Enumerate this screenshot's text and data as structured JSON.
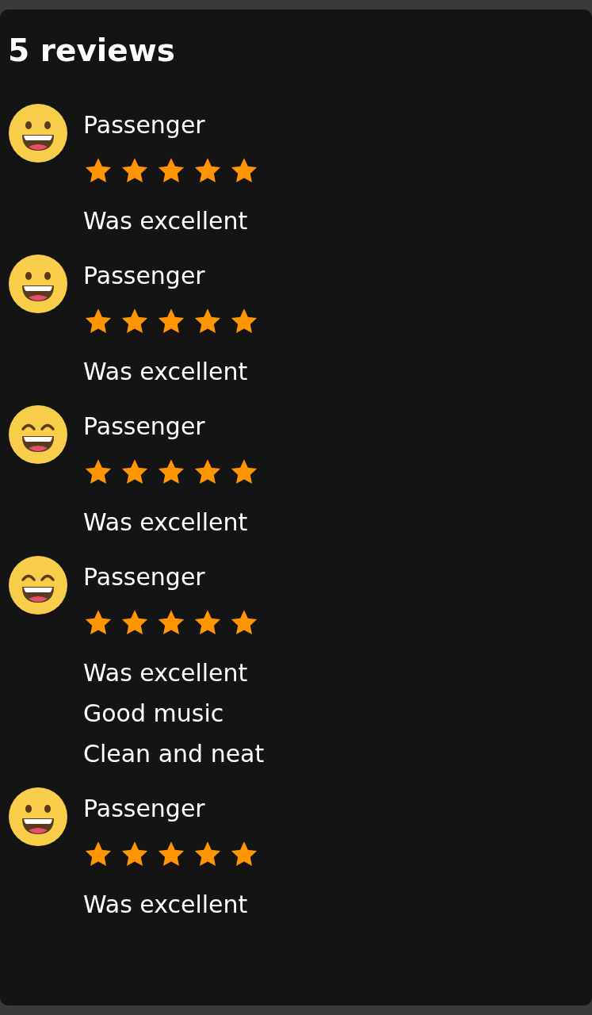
{
  "title": "5 reviews",
  "reviews": [
    {
      "avatar": {
        "kind": "grinning"
      },
      "name": "Passenger",
      "stars": 5,
      "comments": [
        "Was excellent"
      ]
    },
    {
      "avatar": {
        "kind": "grinning"
      },
      "name": "Passenger",
      "stars": 5,
      "comments": [
        "Was excellent"
      ]
    },
    {
      "avatar": {
        "kind": "beaming"
      },
      "name": "Passenger",
      "stars": 5,
      "comments": [
        "Was excellent"
      ]
    },
    {
      "avatar": {
        "kind": "beaming"
      },
      "name": "Passenger",
      "stars": 5,
      "comments": [
        "Was excellent",
        "Good music",
        "Clean and neat"
      ]
    },
    {
      "avatar": {
        "kind": "grinning"
      },
      "name": "Passenger",
      "stars": 5,
      "comments": [
        "Was excellent"
      ]
    }
  ]
}
